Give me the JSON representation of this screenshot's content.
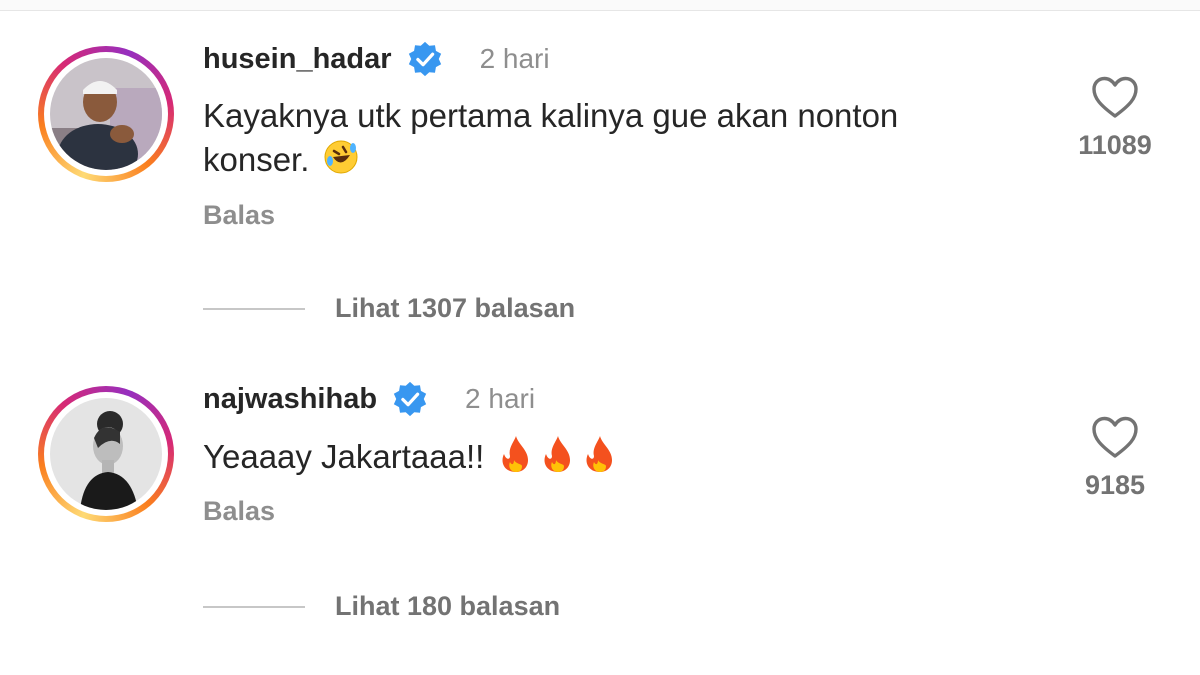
{
  "comments": [
    {
      "username": "husein_hadar",
      "verified": true,
      "time": "2 hari",
      "text": "Kayaknya utk pertama kalinya gue akan nonton konser.",
      "emoji": "rofl-emoji",
      "reply_label": "Balas",
      "likes": "11089",
      "view_replies": "Lihat 1307 balasan"
    },
    {
      "username": "najwashihab",
      "verified": true,
      "time": "2 hari",
      "text": "Yeaaay Jakartaaa!!",
      "emoji": "fire-emoji",
      "reply_label": "Balas",
      "likes": "9185",
      "view_replies": "Lihat 180 balasan"
    }
  ],
  "colors": {
    "verified_blue": "#3897f0",
    "muted_text": "#8e8e8e",
    "primary_text": "#262626"
  }
}
